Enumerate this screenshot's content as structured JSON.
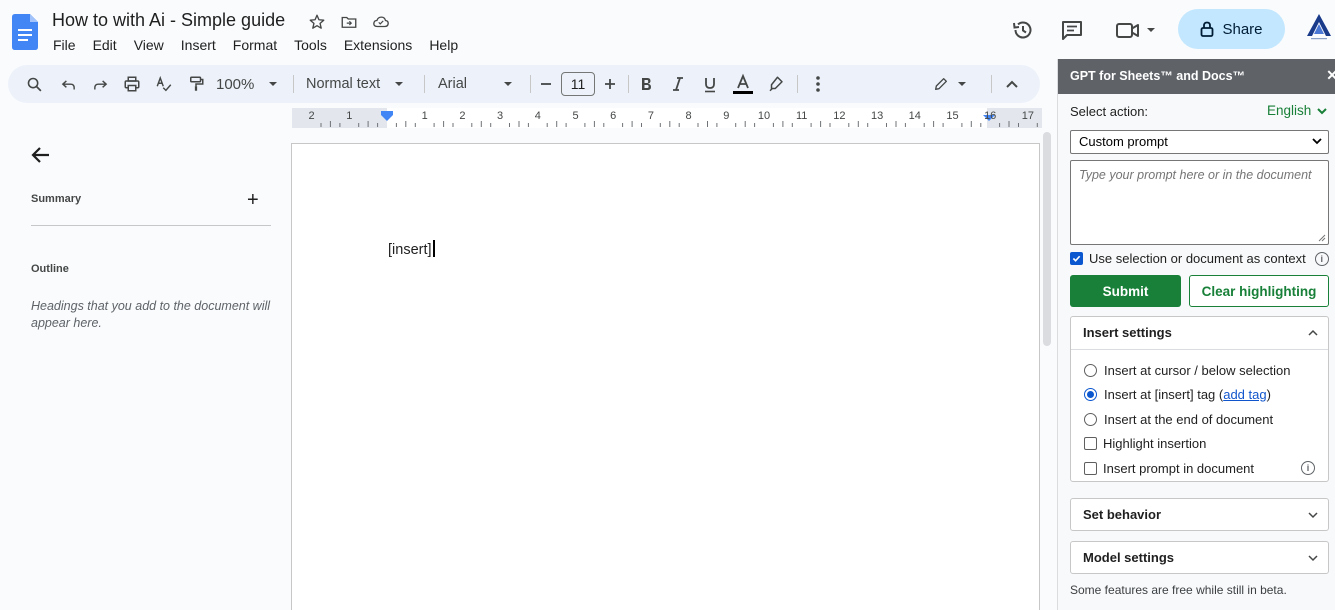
{
  "doc": {
    "title": "How to with Ai - Simple guide",
    "menu": [
      "File",
      "Edit",
      "View",
      "Insert",
      "Format",
      "Tools",
      "Extensions",
      "Help"
    ]
  },
  "header": {
    "share_label": "Share"
  },
  "toolbar": {
    "zoom": "100%",
    "style": "Normal text",
    "font": "Arial",
    "font_size": "11"
  },
  "ruler": {
    "labels": [
      "2",
      "1",
      "1",
      "2",
      "3",
      "4",
      "5",
      "6",
      "7",
      "8",
      "9",
      "10",
      "11",
      "12",
      "13",
      "14",
      "15",
      "16",
      "17"
    ]
  },
  "outline_panel": {
    "summary_label": "Summary",
    "outline_label": "Outline",
    "hint": "Headings that you add to the document will appear here."
  },
  "document": {
    "body_text": "[insert]"
  },
  "sidebar": {
    "title": "GPT for Sheets™ and Docs™",
    "select_action_label": "Select action:",
    "language": "English",
    "action_value": "Custom prompt",
    "prompt_placeholder": "Type your prompt here or in the document",
    "context_checkbox_label": "Use selection or document as context",
    "submit_label": "Submit",
    "clear_label": "Clear highlighting",
    "insert_settings": {
      "title": "Insert settings",
      "opt_cursor": "Insert at cursor / below selection",
      "opt_tag_prefix": "Insert at [insert] tag (",
      "opt_tag_link": "add tag",
      "opt_tag_suffix": ")",
      "opt_end": "Insert at the end of document",
      "opt_highlight": "Highlight insertion",
      "opt_prompt": "Insert prompt in document"
    },
    "set_behavior_title": "Set behavior",
    "model_settings_title": "Model settings",
    "footer": "Some features are free while still in beta."
  }
}
